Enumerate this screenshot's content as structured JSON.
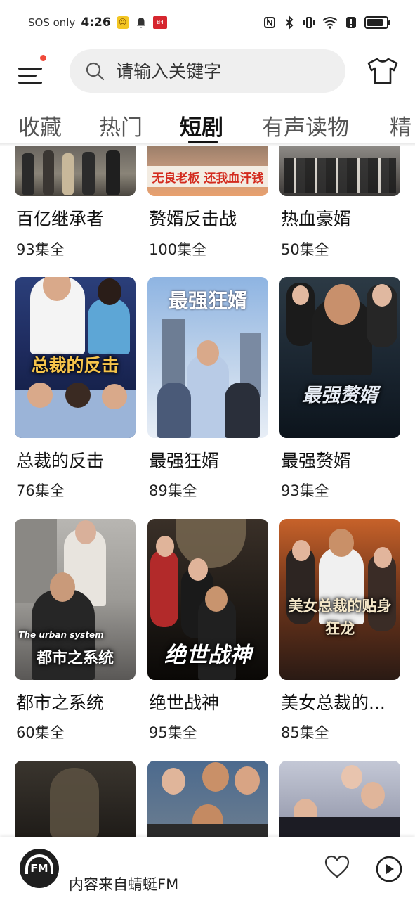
{
  "status_bar": {
    "network": "SOS only",
    "time": "4:26",
    "red_badge": "ꓤꟻ",
    "battery_level": 0.85
  },
  "header": {
    "search_placeholder": "请输入关键字"
  },
  "tabs": [
    {
      "label": "收藏"
    },
    {
      "label": "热门"
    },
    {
      "label": "短剧"
    },
    {
      "label": "有声读物"
    },
    {
      "label": "精"
    }
  ],
  "row1": [
    {
      "title": "百亿继承者",
      "episodes": "93集全"
    },
    {
      "title": "赘婿反击战",
      "episodes": "100集全",
      "cover_text": "无良老板 还我血汗钱"
    },
    {
      "title": "热血豪婿",
      "episodes": "50集全"
    }
  ],
  "row2": [
    {
      "title": "总裁的反击",
      "episodes": "76集全",
      "cover_text": "总裁的反击"
    },
    {
      "title": "最强狂婿",
      "episodes": "89集全",
      "cover_text": "最强狂婿"
    },
    {
      "title": "最强赘婿",
      "episodes": "93集全",
      "cover_text": "最强赘婿"
    }
  ],
  "row3": [
    {
      "title": "都市之系统",
      "episodes": "60集全",
      "cover_text": "都市之系统",
      "cover_subtext": "The urban system"
    },
    {
      "title": "绝世战神",
      "episodes": "95集全",
      "cover_text": "绝世战神"
    },
    {
      "title": "美女总裁的...",
      "episodes": "85集全",
      "cover_text": "美女总裁的贴身狂龙"
    }
  ],
  "player": {
    "logo": "FM",
    "text": "内容来自蜻蜓FM"
  }
}
